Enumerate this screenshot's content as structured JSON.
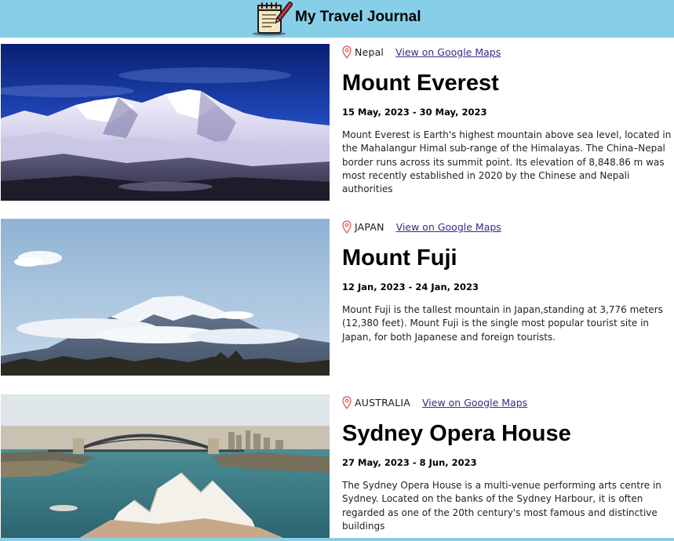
{
  "header": {
    "title": "My Travel Journal",
    "logo_icon": "notebook-pen-icon",
    "background": "#87cfe8"
  },
  "entries": [
    {
      "country": "Nepal",
      "maps_label": "View on Google Maps",
      "title": "Mount Everest",
      "dates": "15 May, 2023 - 30 May, 2023",
      "description": "Mount Everest is Earth's highest mountain above sea level, located in the Mahalangur Himal sub-range of the Himalayas. The China–Nepal border runs across its summit point. Its elevation of 8,848.86 m was most recently established in 2020 by the Chinese and Nepali authorities",
      "image_subject": "snowy-himalaya-peaks-photo"
    },
    {
      "country": "JAPAN",
      "maps_label": "View on Google Maps",
      "title": "Mount Fuji",
      "dates": "12 Jan, 2023 - 24 Jan, 2023",
      "description": "Mount Fuji is the tallest mountain in Japan,standing at 3,776 meters (12,380 feet). Mount Fuji is the single most popular tourist site in Japan, for both Japanese and foreign tourists.",
      "image_subject": "mount-fuji-photo"
    },
    {
      "country": "AUSTRALIA",
      "maps_label": "View on Google Maps",
      "title": "Sydney Opera House",
      "dates": "27 May, 2023 - 8 Jun, 2023",
      "description": "The Sydney Opera House is a multi-venue performing arts centre in Sydney. Located on the banks of the Sydney Harbour, it is often regarded as one of the 20th century's most famous and distinctive buildings",
      "image_subject": "sydney-harbour-opera-house-photo"
    }
  ],
  "colors": {
    "link": "#3a2a82",
    "pin": "#e0555a"
  }
}
